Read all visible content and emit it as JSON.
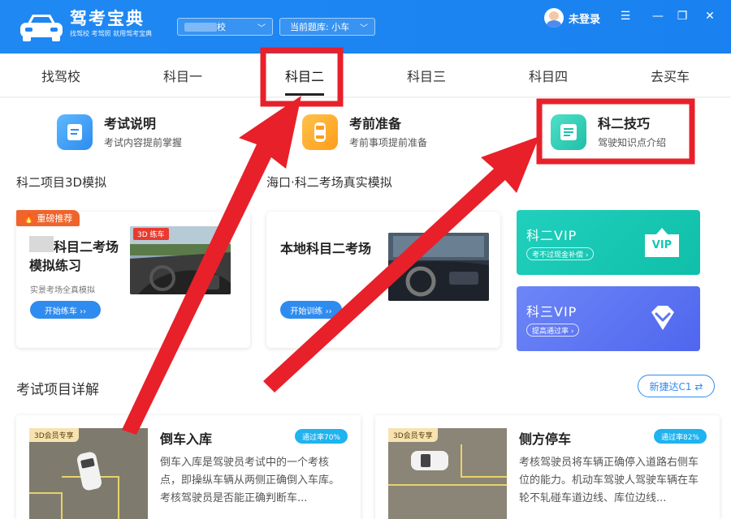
{
  "app": {
    "brand_name": "驾考宝典",
    "brand_slogan": "找驾校 考驾照 就用驾考宝典",
    "school_select_value": "校",
    "question_bank_label": "当前题库: 小车",
    "user_label": "未登录"
  },
  "nav": {
    "tabs": [
      {
        "label": "找驾校"
      },
      {
        "label": "科目一"
      },
      {
        "label": "科目二",
        "active": true
      },
      {
        "label": "科目三"
      },
      {
        "label": "科目四"
      },
      {
        "label": "去买车"
      }
    ]
  },
  "quick_links": [
    {
      "title": "考试说明",
      "sub": "考试内容提前掌握"
    },
    {
      "title": "考前准备",
      "sub": "考前事项提前准备"
    },
    {
      "title": "科二技巧",
      "sub": "驾驶知识点介绍"
    }
  ],
  "sections": {
    "sim3d": "科二项目3D模拟",
    "real": "海口·科二考场真实模拟",
    "details": "考试项目详解"
  },
  "sim3d_card": {
    "hot_tag": "重磅推荐",
    "title_line1": "科目二考场",
    "title_line2": "模拟练习",
    "sub": "实景考场全真模拟",
    "button": "开始练车 ››",
    "badge": "3D 练车"
  },
  "real_card": {
    "title": "本地科目二考场",
    "button": "开始训练 ››"
  },
  "vip": [
    {
      "title": "科二VIP",
      "pill": "考不过现金补偿 ›",
      "color": "#17c7b5",
      "icon_text": "VIP"
    },
    {
      "title": "科三VIP",
      "pill": "提高通过率 ›",
      "color": "#5a75f0"
    }
  ],
  "car_select": "新捷达C1 ⇄",
  "projects": [
    {
      "member_tag": "3D会员专享",
      "title": "倒车入库",
      "pass_rate": "通过率70%",
      "desc": "倒车入库是驾驶员考试中的一个考核点，即操纵车辆从两侧正确倒入车库。考核驾驶员是否能正确判断车..."
    },
    {
      "member_tag": "3D会员专享",
      "title": "侧方停车",
      "pass_rate": "通过率82%",
      "desc": "考核驾驶员将车辆正确停入道路右侧车位的能力。机动车驾驶人驾驶车辆在车轮不轧碰车道边线、库位边线..."
    }
  ],
  "colors": {
    "header_blue": "#1d86f2",
    "annotation_red": "#e8202a"
  }
}
